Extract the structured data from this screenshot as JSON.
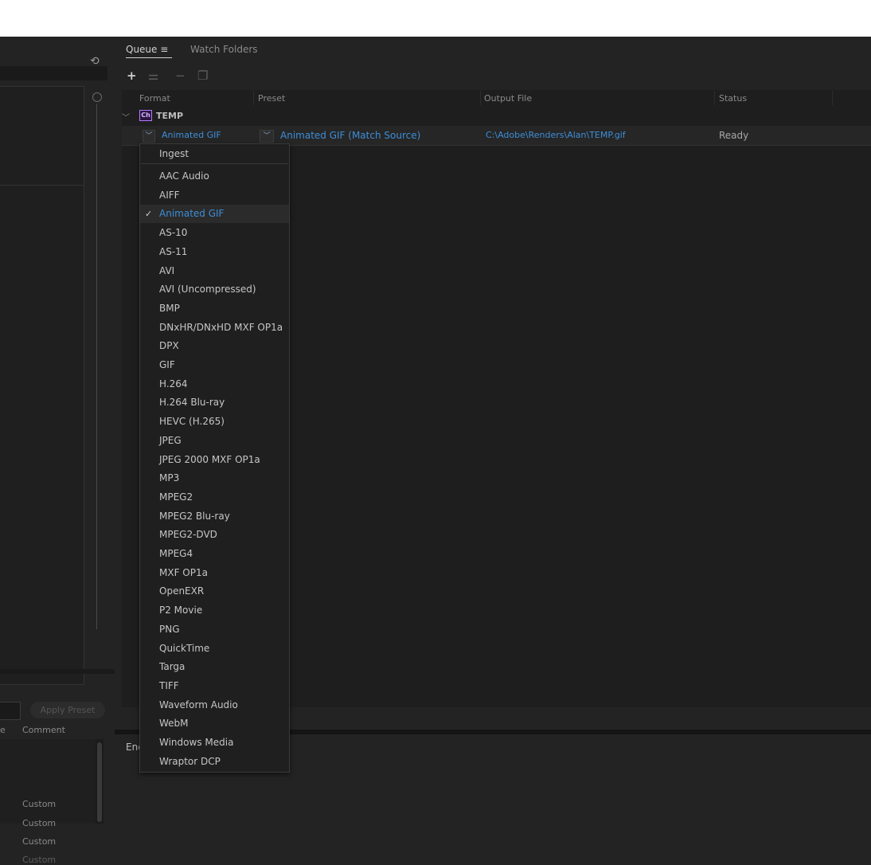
{
  "tabs": {
    "queue": "Queue ≡",
    "watch": "Watch Folders"
  },
  "toolbar": {
    "add": "+",
    "settings": "⚌",
    "remove": "−",
    "duplicate": "❐"
  },
  "columns": {
    "format": "Format",
    "preset": "Preset",
    "output": "Output File",
    "status": "Status"
  },
  "group": {
    "badge": "Ch",
    "name": "TEMP"
  },
  "item": {
    "format": "Animated GIF",
    "preset": "Animated GIF (Match Source)",
    "output": "C:\\Adobe\\Renders\\Alan\\TEMP.gif",
    "status": "Ready"
  },
  "left": {
    "apply_preset": "Apply Preset",
    "col_e": "e",
    "col_comment": "Comment",
    "presets": [
      "Custom",
      "Custom",
      "Custom",
      "Custom"
    ]
  },
  "encoding": {
    "label": "Enc"
  },
  "menu": {
    "ingest": "Ingest",
    "items": [
      "AAC Audio",
      "AIFF",
      "Animated GIF",
      "AS-10",
      "AS-11",
      "AVI",
      "AVI (Uncompressed)",
      "BMP",
      "DNxHR/DNxHD MXF OP1a",
      "DPX",
      "GIF",
      "H.264",
      "H.264 Blu-ray",
      "HEVC (H.265)",
      "JPEG",
      "JPEG 2000 MXF OP1a",
      "MP3",
      "MPEG2",
      "MPEG2 Blu-ray",
      "MPEG2-DVD",
      "MPEG4",
      "MXF OP1a",
      "OpenEXR",
      "P2 Movie",
      "PNG",
      "QuickTime",
      "Targa",
      "TIFF",
      "Waveform Audio",
      "WebM",
      "Windows Media",
      "Wraptor DCP"
    ],
    "selected": "Animated GIF"
  },
  "colors": {
    "accent": "#3d8ed7",
    "badge": "#b37cff"
  }
}
